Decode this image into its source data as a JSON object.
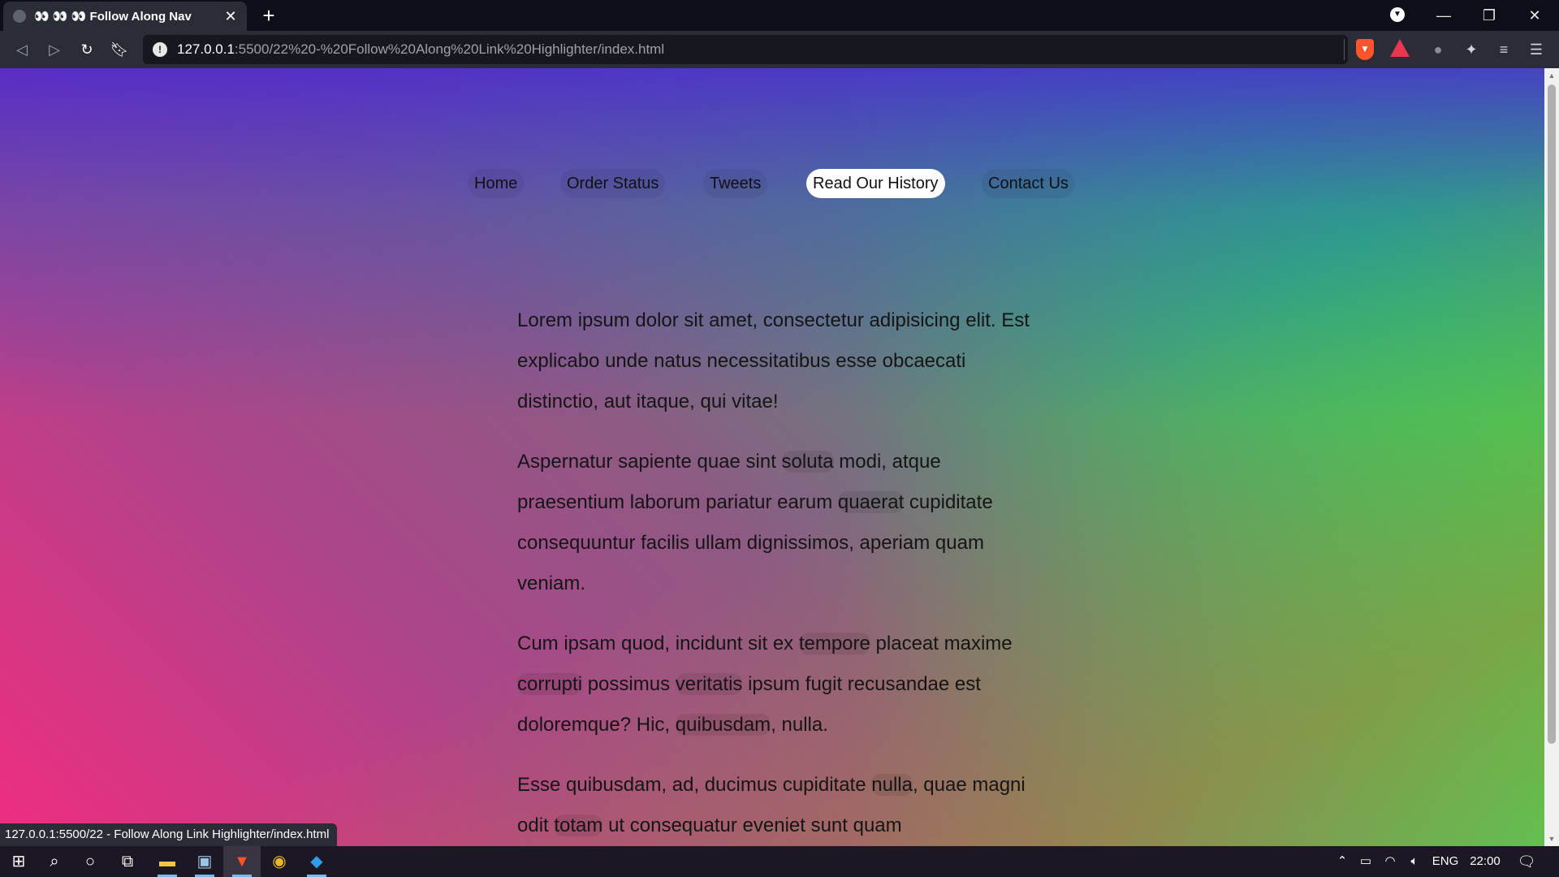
{
  "browser": {
    "tab_title": "👀 👀 👀 Follow Along Nav",
    "tab_close": "✕",
    "new_tab": "+",
    "url_host": "127.0.0.1",
    "url_path": ":5500/22%20-%20Follow%20Along%20Link%20Highlighter/index.html",
    "window_controls": {
      "minimize": "—",
      "restore": "❐",
      "close": "✕"
    }
  },
  "nav": {
    "items": [
      {
        "label": "Home",
        "active": false
      },
      {
        "label": "Order Status",
        "active": false
      },
      {
        "label": "Tweets",
        "active": false
      },
      {
        "label": "Read Our History",
        "active": true
      },
      {
        "label": "Contact Us",
        "active": false
      }
    ]
  },
  "content": {
    "p1": "Lorem ipsum dolor sit amet, consectetur adipisicing elit. Est explicabo unde natus necessitatibus esse obcaecati distinctio, aut itaque, qui vitae!",
    "p2": {
      "t1": "Aspernatur sapiente quae sint ",
      "l1": "soluta",
      "t2": " modi, atque praesentium laborum pariatur earum ",
      "l2": "quaerat",
      "t3": " cupiditate consequuntur facilis ullam dignissimos, aperiam quam veniam."
    },
    "p3": {
      "t1": "Cum ipsam quod, incidunt sit ex ",
      "l1": "tempore",
      "t2": " placeat maxime ",
      "l2": "corrupti",
      "t3": " possimus ",
      "l3": "veritatis",
      "t4": " ipsum fugit recusandae est doloremque? Hic, ",
      "l4": "quibusdam",
      "t5": ", nulla."
    },
    "p4": {
      "t1": "Esse quibusdam, ad, ducimus cupiditate ",
      "l1": "nulla",
      "t2": ", quae magni odit ",
      "l2": "totam",
      "t3": " ut consequatur eveniet sunt quam"
    }
  },
  "status_bar": "127.0.0.1:5500/22 - Follow Along Link Highlighter/index.html",
  "taskbar": {
    "language": "ENG",
    "time": "22:00"
  },
  "colors": {
    "gradient_top": "#5a2fd0",
    "gradient_bottom_left": "#f02d80",
    "gradient_right": "#10d873",
    "active_pill": "#ffffff"
  }
}
